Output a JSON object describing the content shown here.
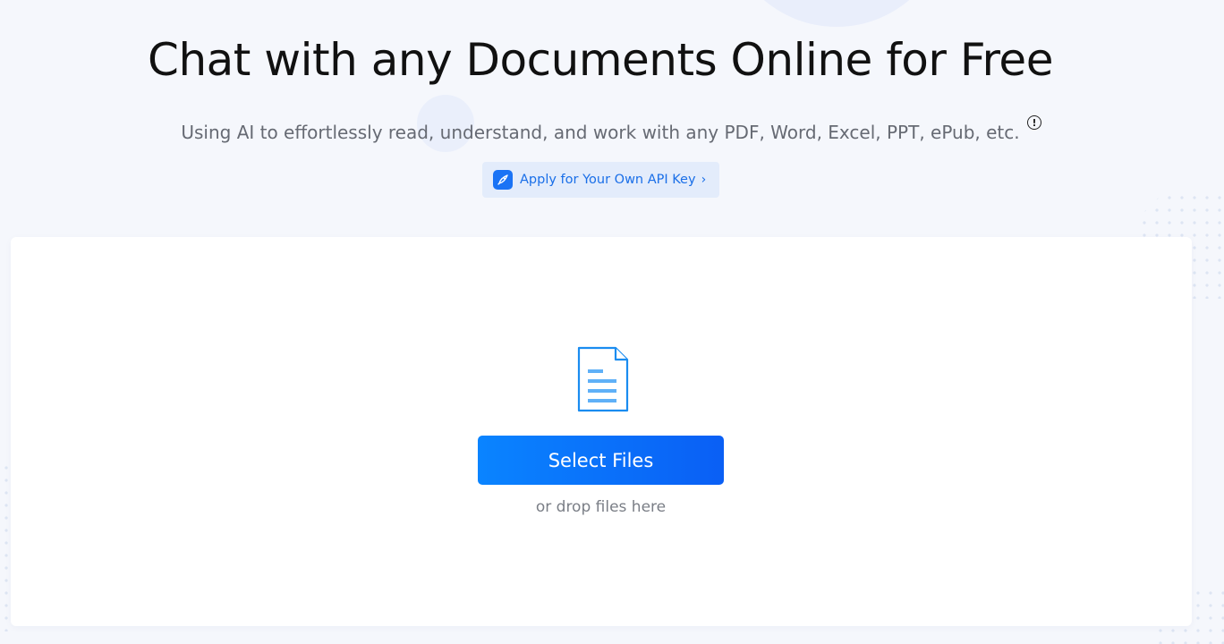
{
  "hero": {
    "title": "Chat with any Documents Online for Free",
    "subtitle": "Using AI to effortlessly read, understand, and work with any PDF, Word, Excel, PPT, ePub, etc.",
    "info_icon": "info-icon",
    "api_button": {
      "label": "Apply for Your Own API Key",
      "chevron": "›",
      "icon": "rocket-icon"
    }
  },
  "upload": {
    "icon": "document-icon",
    "select_button_label": "Select Files",
    "drop_hint": "or drop files here"
  },
  "colors": {
    "accent": "#0a7aff",
    "api_bg": "#e3ecfb",
    "page_bg": "#f5f7fc"
  }
}
